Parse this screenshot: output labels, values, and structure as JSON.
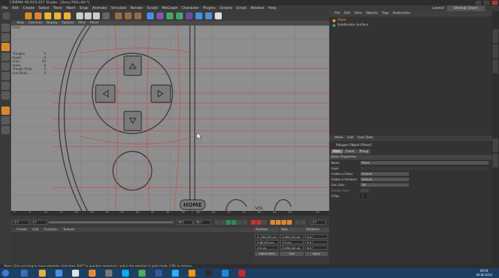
{
  "window": {
    "title": "CINEMA 4D R15.057 Studio - [Sony PS4.c4d *]"
  },
  "menubar": [
    "File",
    "Edit",
    "Create",
    "Select",
    "Tools",
    "Mesh",
    "Snap",
    "Animate",
    "Simulate",
    "Render",
    "Sculpt",
    "MoGraph",
    "Character",
    "Plugins",
    "Octane",
    "Script",
    "Window",
    "Help"
  ],
  "layout": {
    "label": "Layout",
    "value": "Startup (User)"
  },
  "viewport": {
    "menu": [
      "View",
      "Cameras",
      "Display",
      "Options",
      "Filter",
      "Panel"
    ],
    "name": "Front",
    "stats": [
      {
        "label": "Triangles",
        "value": "0"
      },
      {
        "label": "Quads",
        "value": "0"
      },
      {
        "label": "Lines",
        "value": "63"
      },
      {
        "label": "Points",
        "value": "0"
      },
      {
        "label": "Triangle Strips",
        "value": "0"
      },
      {
        "label": "Line Strips",
        "value": "0"
      }
    ],
    "home_label": "HOME",
    "vol_label": "VOL"
  },
  "timeline": {
    "ticks": [
      "0",
      "5",
      "10",
      "15",
      "20",
      "25",
      "30",
      "35",
      "40",
      "45",
      "50",
      "55",
      "60",
      "65",
      "70",
      "75",
      "80",
      "85",
      "90",
      "0 F"
    ],
    "start": "0 F",
    "current": "0 F",
    "end": "90 F",
    "end2": "90 F",
    "frame_readout": "0 F"
  },
  "materials": {
    "menu": [
      "Create",
      "Edit",
      "Function",
      "Texture"
    ]
  },
  "coordinates": {
    "headers": [
      "Position",
      "Size",
      "Rotation"
    ],
    "rows": [
      [
        "X  -192.237 cm",
        "X  361.153 cm",
        "H  0 °"
      ],
      [
        "Y  96.415 cm",
        "Y  0 cm",
        "P  0 °"
      ],
      [
        "Z  0 cm",
        "Z  160.144 cm",
        "B  0 °"
      ]
    ],
    "object_mode": "Object (Rel)",
    "size_mode": "Size",
    "apply": "Apply"
  },
  "objects": {
    "menu": [
      "File",
      "Edit",
      "View",
      "Objects",
      "Tags",
      "Bookmarks"
    ],
    "items": [
      {
        "name": "Plane",
        "selected": true,
        "color": "#f6a623"
      },
      {
        "name": "Subdivision Surface",
        "selected": false,
        "color": "#38b26a"
      }
    ]
  },
  "attributes": {
    "menu": [
      "Mode",
      "Edit",
      "User Data"
    ],
    "title": "Polygon Object [Plane]",
    "tabs": [
      "Basic",
      "Coord.",
      "Phong"
    ],
    "section": "Basic Properties",
    "props": [
      {
        "label": "Name",
        "value": "Plane",
        "dim": false
      },
      {
        "label": "Layer",
        "value": "",
        "dim": false
      },
      {
        "label": "Visible in Editor",
        "value": "Default",
        "dim": false
      },
      {
        "label": "Visible in Renderer",
        "value": "Default",
        "dim": false
      },
      {
        "label": "Use Color",
        "value": "Off",
        "dim": false
      },
      {
        "label": "Display Color",
        "value": "",
        "dim": true
      },
      {
        "label": "X-Ray",
        "value": "✔",
        "dim": false
      }
    ]
  },
  "status": "Move: Click and drag to move elements. Hold down SHIFT to quantize movement / add to the selection in point mode, CTRL to remove.",
  "clock": {
    "time": "00:00",
    "date": "06.06.2014"
  },
  "colors": {
    "accent": "#f6a623",
    "viewport": "#8e8e8e",
    "guide": "#c84a4a"
  }
}
